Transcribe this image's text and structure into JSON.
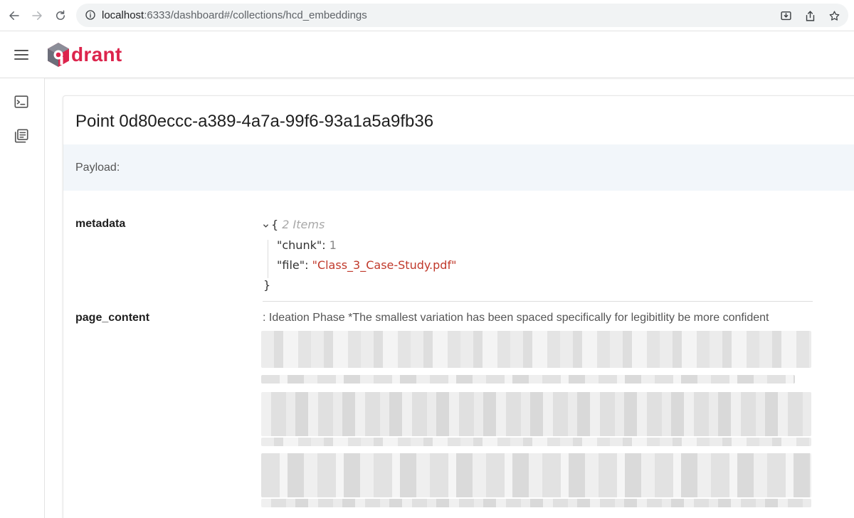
{
  "browser": {
    "url_host": "localhost",
    "url_path": ":6333/dashboard#/collections/hcd_embeddings"
  },
  "app": {
    "brand": "drant",
    "brand_color": "#dc244c"
  },
  "icons": {
    "back": "arrow-left-icon",
    "forward": "arrow-right-icon",
    "reload": "reload-icon",
    "site_info": "info-circle-icon",
    "install": "install-icon",
    "share": "share-icon",
    "bookmark": "star-icon",
    "menu": "hamburger-icon",
    "console": "terminal-icon",
    "collections": "library-icon"
  },
  "point": {
    "title": "Point 0d80eccc-a389-4a7a-99f6-93a1a5a9fb36",
    "payload_label": "Payload:",
    "fields": [
      {
        "key": "metadata",
        "open_brace": "{",
        "item_count": "2 Items",
        "entries": [
          {
            "key": "\"chunk\"",
            "value": "1"
          },
          {
            "key": "\"file\"",
            "value": "\"Class_3_Case-Study.pdf\""
          }
        ],
        "close_brace": "}"
      },
      {
        "key": "page_content",
        "first_line": ": Ideation Phase *The smallest variation has been spaced specifically for legibitlity be more confident"
      }
    ]
  }
}
